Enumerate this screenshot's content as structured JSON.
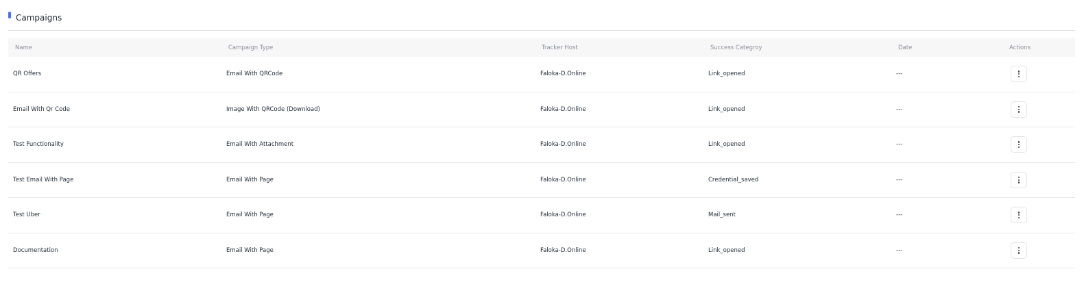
{
  "header": {
    "title": "Campaigns"
  },
  "colors": {
    "accent": "#4f6ef7",
    "header_bg": "#f7f7f8",
    "divider": "#e2e4e8"
  },
  "table": {
    "columns": {
      "name": "Name",
      "campaign_type": "Campaign Type",
      "tracker_host": "Tracker Host",
      "success_category": "Success Categroy",
      "date": "Date",
      "actions": "Actions"
    },
    "rows": [
      {
        "name": "QR Offers",
        "campaign_type": "Email With QRCode",
        "tracker_host": "Faloka-D.Online",
        "success_category": "Link_opened",
        "date": "---",
        "action_icon": "more-vertical-icon"
      },
      {
        "name": "Email With Qr Code",
        "campaign_type": "Image With QRCode (Download)",
        "tracker_host": "Faloka-D.Online",
        "success_category": "Link_opened",
        "date": "---",
        "action_icon": "more-vertical-icon"
      },
      {
        "name": "Test Functionality",
        "campaign_type": "Email With Attachment",
        "tracker_host": "Faloka-D.Online",
        "success_category": "Link_opened",
        "date": "---",
        "action_icon": "more-vertical-icon"
      },
      {
        "name": "Test Email With Page",
        "campaign_type": "Email With Page",
        "tracker_host": "Faloka-D.Online",
        "success_category": "Credential_saved",
        "date": "---",
        "action_icon": "more-vertical-icon"
      },
      {
        "name": "Test Uber",
        "campaign_type": "Email With Page",
        "tracker_host": "Faloka-D.Online",
        "success_category": "Mail_sent",
        "date": "---",
        "action_icon": "more-vertical-icon"
      },
      {
        "name": "Documentation",
        "campaign_type": "Email With Page",
        "tracker_host": "Faloka-D.Online",
        "success_category": "Link_opened",
        "date": "---",
        "action_icon": "more-vertical-icon"
      }
    ]
  }
}
